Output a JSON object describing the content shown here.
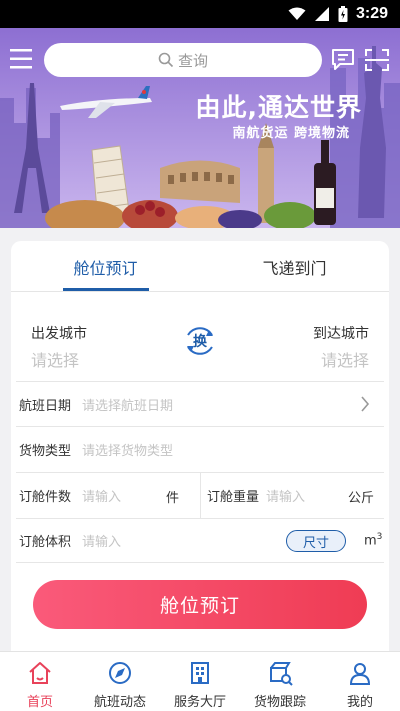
{
  "status_bar": {
    "time": "3:29"
  },
  "header": {
    "search_placeholder": "查询"
  },
  "banner": {
    "headline": "由此,通达世界",
    "subline": "南航货运  跨境物流"
  },
  "booking": {
    "tabs": [
      {
        "label": "舱位预订",
        "active": true
      },
      {
        "label": "飞递到门",
        "active": false
      }
    ],
    "origin": {
      "label": "出发城市",
      "placeholder": "请选择"
    },
    "destination": {
      "label": "到达城市",
      "placeholder": "请选择"
    },
    "swap_label": "换",
    "flight_date": {
      "label": "航班日期",
      "placeholder": "请选择航班日期"
    },
    "cargo_type": {
      "label": "货物类型",
      "placeholder": "请选择货物类型"
    },
    "pieces": {
      "label": "订舱件数",
      "placeholder": "请输入",
      "unit": "件"
    },
    "weight": {
      "label": "订舱重量",
      "placeholder": "请输入",
      "unit": "公斤"
    },
    "volume": {
      "label": "订舱体积",
      "placeholder": "请输入",
      "size_button": "尺寸",
      "unit": "m",
      "unit_sup": "3"
    },
    "submit_label": "舱位预订"
  },
  "tabbar": {
    "items": [
      {
        "label": "首页",
        "icon": "home-icon",
        "active": true
      },
      {
        "label": "航班动态",
        "icon": "flight-compass-icon",
        "active": false
      },
      {
        "label": "服务大厅",
        "icon": "building-icon",
        "active": false
      },
      {
        "label": "货物跟踪",
        "icon": "cargo-tracking-icon",
        "active": false
      },
      {
        "label": "我的",
        "icon": "user-icon",
        "active": false
      }
    ]
  },
  "colors": {
    "accent": "#1f5da8",
    "submit_start": "#fa5a7a",
    "submit_end": "#ef3c54",
    "tab_active": "#e8425a"
  }
}
